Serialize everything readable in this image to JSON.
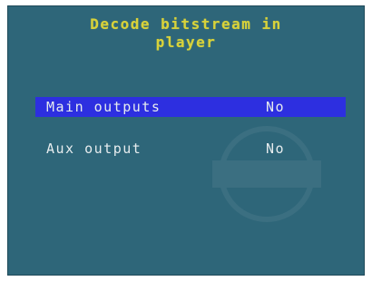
{
  "menu": {
    "title_line1": "Decode bitstream in",
    "title_line2": "player",
    "items": [
      {
        "label": "Main outputs",
        "value": "No",
        "selected": true
      },
      {
        "label": "Aux output",
        "value": "No",
        "selected": false
      }
    ]
  },
  "colors": {
    "background": "#2e6679",
    "title": "#d8d23a",
    "text": "#e6ecee",
    "highlight": "#2d2fe0"
  }
}
